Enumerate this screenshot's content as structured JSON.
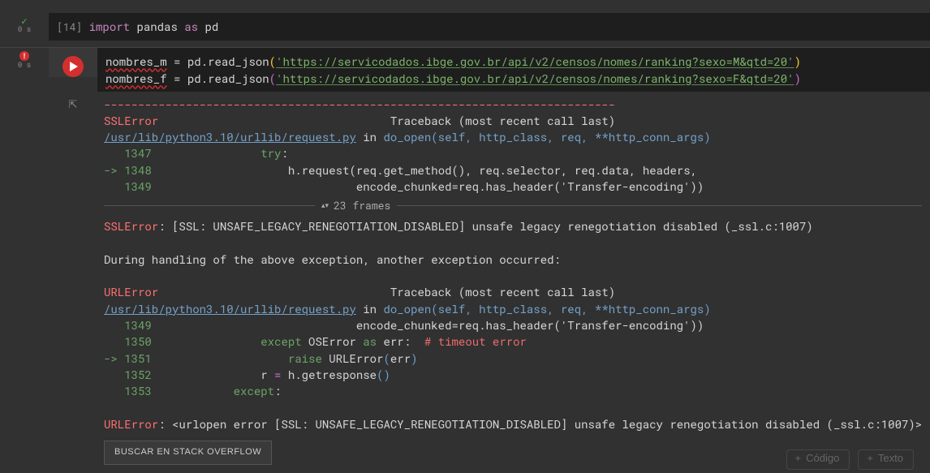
{
  "cell1": {
    "status_time": "0 s",
    "prompt": "[14]",
    "kw_import": "import",
    "mod": "pandas",
    "kw_as": "as",
    "alias": "pd"
  },
  "cell2": {
    "status_time": "0 s",
    "var_m": "nombres_m",
    "var_f": "nombres_f",
    "eq": "=",
    "call": "pd.read_json",
    "url_m": "'https://servicodados.ibge.gov.br/api/v2/censos/nomes/ranking?sexo=M&qtd=20'",
    "url_f": "'https://servicodados.ibge.gov.br/api/v2/censos/nomes/ranking?sexo=F&qtd=20'",
    "lp": "(",
    "rp": ")"
  },
  "trace": {
    "dashes": "---------------------------------------------------------------------------",
    "ssl": "SSLError",
    "url": "URLError",
    "tb": "Traceback (most recent call last)",
    "file": "/usr/lib/python3.10/urllib/request.py",
    "in": " in ",
    "do_open": "do_open",
    "sig": "(self, http_class, req, **http_conn_args)",
    "l1347_n": "   1347",
    "l1347_c": "                try:",
    "l1348_a": "-> 1348",
    "l1348_c": "                    h.request(req.get_method(), req.selector, req.data, headers,",
    "l1349_n": "   1349",
    "l1349_c": "                              encode_chunked=req.has_header('Transfer-encoding'))",
    "frames": "23 frames",
    "ssl_msg": ": [SSL: UNSAFE_LEGACY_RENEGOTIATION_DISABLED] unsafe legacy renegotiation disabled (_ssl.c:1007)",
    "during": "During handling of the above exception, another exception occurred:",
    "l1349b_n": "   1349",
    "l1350_n": "   1350",
    "l1350_c1": "                except",
    "l1350_c2": " OSError ",
    "l1350_as": "as",
    "l1350_c3": " err",
    "l1350_colon": ":",
    "l1350_comm": "  # timeout error",
    "l1351_a": "-> 1351",
    "l1351_c1": "                    raise",
    "l1351_c2": " URLError",
    "l1351_c3": "(err)",
    "l1352_n": "   1352",
    "l1352_c": "                r = h.getresponse()",
    "l1353_n": "   1353",
    "l1353_c": "            except:",
    "url_msg": ": <urlopen error [SSL: UNSAFE_LEGACY_RENEGOTIATION_DISABLED] unsafe legacy renegotiation disabled (_ssl.c:1007)>",
    "so_btn": "BUSCAR EN STACK OVERFLOW"
  },
  "footer": {
    "code": "Código",
    "text": "Texto"
  }
}
